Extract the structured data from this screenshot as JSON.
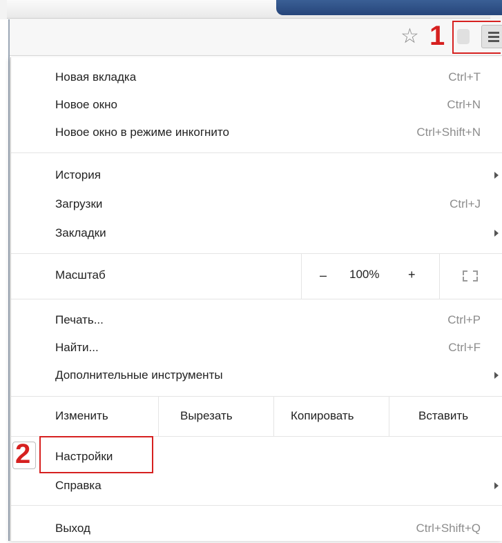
{
  "annotations": {
    "step1": "1",
    "step2": "2"
  },
  "toolbar": {
    "bookmark_icon": "star-icon",
    "menu_icon": "hamburger-icon"
  },
  "menu": {
    "group1": [
      {
        "label": "Новая вкладка",
        "shortcut": "Ctrl+T"
      },
      {
        "label": "Новое окно",
        "shortcut": "Ctrl+N"
      },
      {
        "label": "Новое окно в режиме инкогнито",
        "shortcut": "Ctrl+Shift+N"
      }
    ],
    "group2": [
      {
        "label": "История",
        "shortcut": "",
        "submenu": true
      },
      {
        "label": "Загрузки",
        "shortcut": "Ctrl+J"
      },
      {
        "label": "Закладки",
        "shortcut": "",
        "submenu": true
      }
    ],
    "zoom": {
      "label": "Масштаб",
      "minus": "–",
      "value": "100%",
      "plus": "+"
    },
    "group3": [
      {
        "label": "Печать...",
        "shortcut": "Ctrl+P"
      },
      {
        "label": "Найти...",
        "shortcut": "Ctrl+F"
      },
      {
        "label": "Дополнительные инструменты",
        "shortcut": "",
        "submenu": true
      }
    ],
    "edit": {
      "label": "Изменить",
      "cut": "Вырезать",
      "copy": "Копировать",
      "paste": "Вставить"
    },
    "group4": [
      {
        "label": "Настройки",
        "shortcut": ""
      },
      {
        "label": "Справка",
        "shortcut": "",
        "submenu": true
      }
    ],
    "exit": {
      "label": "Выход",
      "shortcut": "Ctrl+Shift+Q"
    }
  },
  "colors": {
    "highlight": "#d6201f",
    "shortcut": "#8c8c8c"
  }
}
